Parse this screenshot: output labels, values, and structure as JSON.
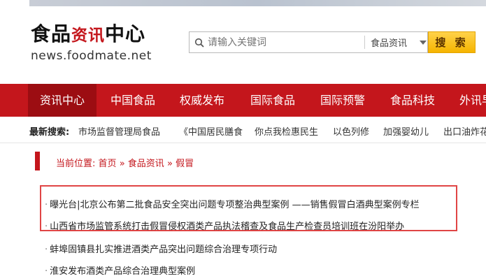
{
  "header": {
    "logo_main": "食品",
    "logo_red": "资讯",
    "logo_tail": "中心",
    "logo_url": "news.foodmate.net"
  },
  "search": {
    "placeholder": "请输入关键词",
    "category": "食品资讯",
    "button_label": "搜 索"
  },
  "nav": {
    "items": [
      "资讯中心",
      "中国食品",
      "权威发布",
      "国际食品",
      "国际预警",
      "食品科技",
      "外讯早"
    ]
  },
  "hot_search": {
    "label": "最新搜索:",
    "items": [
      "市场监督管理局食品",
      "《中国居民膳食",
      "你点我检惠民生",
      "以色列修",
      "加强婴幼儿",
      "出口油炸花"
    ]
  },
  "breadcrumb": {
    "prefix": "当前位置:",
    "home": "首页",
    "sep1": "»",
    "section": "食品资讯",
    "sep2": "»",
    "current": "假冒"
  },
  "articles": [
    "曝光台|北京公布第二批食品安全突出问题专项整治典型案例 ——销售假冒白酒典型案例专栏",
    "山西省市场监管系统打击假冒侵权酒类产品执法稽查及食品生产检查员培训班在汾阳举办",
    "蚌埠固镇县扎实推进酒类产品突出问题综合治理专项行动",
    "淮安发布酒类产品综合治理典型案例"
  ],
  "colors": {
    "brand_red": "#c4161c",
    "highlight_border": "#e04545",
    "button_yellow": "#f5b400"
  }
}
